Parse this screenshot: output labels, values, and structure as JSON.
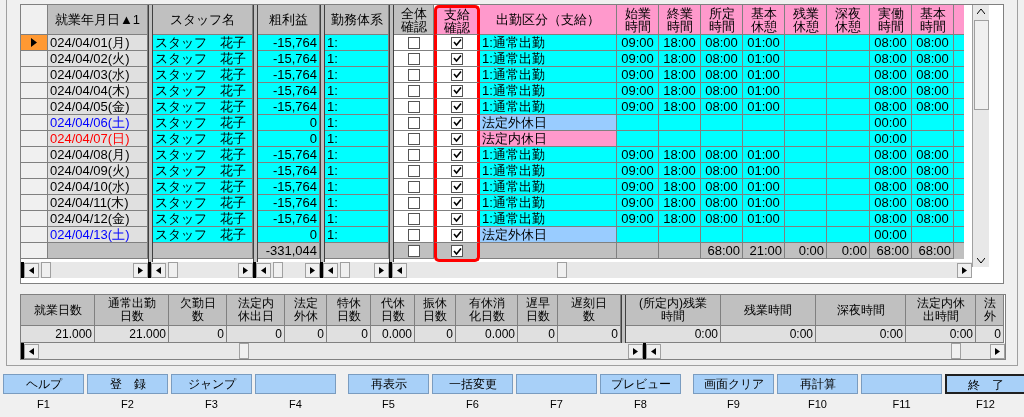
{
  "grid": {
    "columns": [
      {
        "lines": [
          "就業年月日▲1"
        ]
      },
      {
        "lines": [
          "スタッフ名"
        ]
      },
      {
        "lines": [
          "粗利益"
        ]
      },
      {
        "lines": [
          "勤務体系"
        ]
      },
      {
        "lines": [
          "全体",
          "確認"
        ]
      },
      {
        "lines": [
          "支給",
          "確認"
        ]
      },
      {
        "lines": [
          "出勤区分（支給）"
        ]
      },
      {
        "lines": [
          "始業",
          "時間"
        ]
      },
      {
        "lines": [
          "終業",
          "時間"
        ]
      },
      {
        "lines": [
          "所定",
          "時間"
        ]
      },
      {
        "lines": [
          "基本",
          "休憩"
        ]
      },
      {
        "lines": [
          "残業",
          "休憩"
        ]
      },
      {
        "lines": [
          "深夜",
          "休憩"
        ]
      },
      {
        "lines": [
          "実働",
          "時間"
        ]
      },
      {
        "lines": [
          "基本",
          "時間"
        ]
      }
    ],
    "rows": [
      {
        "selected": true,
        "date": {
          "text": "024/04/01(月)",
          "color": "#000000"
        },
        "staff": "スタッフ　花子",
        "profit": "-15,764",
        "shift": "1:",
        "all_check": false,
        "pay_check": true,
        "attendance": {
          "text": "1:通常出勤",
          "color": "#00ffff"
        },
        "start": "09:00",
        "end": "18:00",
        "scheduled": "08:00",
        "base_break": "01:00",
        "actual": "08:00",
        "base_time": "08:00"
      },
      {
        "selected": false,
        "date": {
          "text": "024/04/02(火)",
          "color": "#000000"
        },
        "staff": "スタッフ　花子",
        "profit": "-15,764",
        "shift": "1:",
        "all_check": false,
        "pay_check": true,
        "attendance": {
          "text": "1:通常出勤",
          "color": "#00ffff"
        },
        "start": "09:00",
        "end": "18:00",
        "scheduled": "08:00",
        "base_break": "01:00",
        "actual": "08:00",
        "base_time": "08:00"
      },
      {
        "selected": false,
        "date": {
          "text": "024/04/03(水)",
          "color": "#000000"
        },
        "staff": "スタッフ　花子",
        "profit": "-15,764",
        "shift": "1:",
        "all_check": false,
        "pay_check": true,
        "attendance": {
          "text": "1:通常出勤",
          "color": "#00ffff"
        },
        "start": "09:00",
        "end": "18:00",
        "scheduled": "08:00",
        "base_break": "01:00",
        "actual": "08:00",
        "base_time": "08:00"
      },
      {
        "selected": false,
        "date": {
          "text": "024/04/04(木)",
          "color": "#000000"
        },
        "staff": "スタッフ　花子",
        "profit": "-15,764",
        "shift": "1:",
        "all_check": false,
        "pay_check": true,
        "attendance": {
          "text": "1:通常出勤",
          "color": "#00ffff"
        },
        "start": "09:00",
        "end": "18:00",
        "scheduled": "08:00",
        "base_break": "01:00",
        "actual": "08:00",
        "base_time": "08:00"
      },
      {
        "selected": false,
        "date": {
          "text": "024/04/05(金)",
          "color": "#000000"
        },
        "staff": "スタッフ　花子",
        "profit": "-15,764",
        "shift": "1:",
        "all_check": false,
        "pay_check": true,
        "attendance": {
          "text": "1:通常出勤",
          "color": "#00ffff"
        },
        "start": "09:00",
        "end": "18:00",
        "scheduled": "08:00",
        "base_break": "01:00",
        "actual": "08:00",
        "base_time": "08:00"
      },
      {
        "selected": false,
        "date": {
          "text": "024/04/06(土)",
          "color": "#0000ff"
        },
        "staff": "スタッフ　花子",
        "profit": "0",
        "shift": "1:",
        "all_check": false,
        "pay_check": true,
        "attendance": {
          "text": "法定外休日",
          "color": "#99ccff"
        },
        "actual": "00:00"
      },
      {
        "selected": false,
        "date": {
          "text": "024/04/07(日)",
          "color": "#ff0000"
        },
        "staff": "スタッフ　花子",
        "profit": "0",
        "shift": "1:",
        "all_check": false,
        "pay_check": true,
        "attendance": {
          "text": "法定内休日",
          "color": "#ff99cc"
        },
        "actual": "00:00"
      },
      {
        "selected": false,
        "date": {
          "text": "024/04/08(月)",
          "color": "#000000"
        },
        "staff": "スタッフ　花子",
        "profit": "-15,764",
        "shift": "1:",
        "all_check": false,
        "pay_check": true,
        "attendance": {
          "text": "1:通常出勤",
          "color": "#00ffff"
        },
        "start": "09:00",
        "end": "18:00",
        "scheduled": "08:00",
        "base_break": "01:00",
        "actual": "08:00",
        "base_time": "08:00"
      },
      {
        "selected": false,
        "date": {
          "text": "024/04/09(火)",
          "color": "#000000"
        },
        "staff": "スタッフ　花子",
        "profit": "-15,764",
        "shift": "1:",
        "all_check": false,
        "pay_check": true,
        "attendance": {
          "text": "1:通常出勤",
          "color": "#00ffff"
        },
        "start": "09:00",
        "end": "18:00",
        "scheduled": "08:00",
        "base_break": "01:00",
        "actual": "08:00",
        "base_time": "08:00"
      },
      {
        "selected": false,
        "date": {
          "text": "024/04/10(水)",
          "color": "#000000"
        },
        "staff": "スタッフ　花子",
        "profit": "-15,764",
        "shift": "1:",
        "all_check": false,
        "pay_check": true,
        "attendance": {
          "text": "1:通常出勤",
          "color": "#00ffff"
        },
        "start": "09:00",
        "end": "18:00",
        "scheduled": "08:00",
        "base_break": "01:00",
        "actual": "08:00",
        "base_time": "08:00"
      },
      {
        "selected": false,
        "date": {
          "text": "024/04/11(木)",
          "color": "#000000"
        },
        "staff": "スタッフ　花子",
        "profit": "-15,764",
        "shift": "1:",
        "all_check": false,
        "pay_check": true,
        "attendance": {
          "text": "1:通常出勤",
          "color": "#00ffff"
        },
        "start": "09:00",
        "end": "18:00",
        "scheduled": "08:00",
        "base_break": "01:00",
        "actual": "08:00",
        "base_time": "08:00"
      },
      {
        "selected": false,
        "date": {
          "text": "024/04/12(金)",
          "color": "#000000"
        },
        "staff": "スタッフ　花子",
        "profit": "-15,764",
        "shift": "1:",
        "all_check": false,
        "pay_check": true,
        "attendance": {
          "text": "1:通常出勤",
          "color": "#00ffff"
        },
        "start": "09:00",
        "end": "18:00",
        "scheduled": "08:00",
        "base_break": "01:00",
        "actual": "08:00",
        "base_time": "08:00"
      },
      {
        "selected": false,
        "date": {
          "text": "024/04/13(土)",
          "color": "#0000ff"
        },
        "staff": "スタッフ　花子",
        "profit": "0",
        "shift": "1:",
        "all_check": false,
        "pay_check": true,
        "attendance": {
          "text": "法定外休日",
          "color": "#99ccff"
        },
        "actual": "00:00"
      }
    ],
    "totals": {
      "profit": "-331,044",
      "all_check": false,
      "pay_check": true,
      "scheduled": "68:00",
      "base_break": "21:00",
      "ot_break": "0:00",
      "night_break": "0:00",
      "actual": "68:00",
      "base_time": "68:00"
    }
  },
  "summary": {
    "left": [
      {
        "lines": [
          "就業日数"
        ],
        "value": "21.000"
      },
      {
        "lines": [
          "通常出勤",
          "日数"
        ],
        "value": "21.000"
      },
      {
        "lines": [
          "欠勤日",
          "数"
        ],
        "value": "0"
      },
      {
        "lines": [
          "法定内",
          "休出日"
        ],
        "value": "0"
      },
      {
        "lines": [
          "法定",
          "外休"
        ],
        "value": "0"
      },
      {
        "lines": [
          "特休",
          "日数"
        ],
        "value": "0"
      },
      {
        "lines": [
          "代休",
          "日数"
        ],
        "value": "0.000"
      },
      {
        "lines": [
          "振休",
          "日数"
        ],
        "value": "0"
      },
      {
        "lines": [
          "有休消",
          "化日数"
        ],
        "value": "0.000"
      },
      {
        "lines": [
          "遅早",
          "日数"
        ],
        "value": "0"
      },
      {
        "lines": [
          "遅刻日",
          "数"
        ],
        "value": "0"
      }
    ],
    "right": [
      {
        "lines": [
          "(所定内)残業",
          "時間"
        ],
        "value": "0:00"
      },
      {
        "lines": [
          "残業時間"
        ],
        "value": "0:00"
      },
      {
        "lines": [
          "深夜時間"
        ],
        "value": "0:00"
      },
      {
        "lines": [
          "法定内休",
          "出時間"
        ],
        "value": "0:00"
      },
      {
        "lines": [
          "法",
          "外"
        ],
        "value": "0"
      }
    ]
  },
  "function_keys": [
    {
      "label": "ヘルプ",
      "key": "F1",
      "default": false
    },
    {
      "label": "登　録",
      "key": "F2",
      "default": false
    },
    {
      "label": "ジャンプ",
      "key": "F3",
      "default": false
    },
    {
      "key": "F4",
      "default": false
    },
    {
      "label": "再表示",
      "key": "F5",
      "default": false
    },
    {
      "label": "一括変更",
      "key": "F6",
      "default": false
    },
    {
      "key": "F7",
      "default": false
    },
    {
      "label": "プレビュー",
      "key": "F8",
      "default": false
    },
    {
      "label": "画面クリア",
      "key": "F9",
      "default": false
    },
    {
      "label": "再計算",
      "key": "F10",
      "default": false
    },
    {
      "key": "F11",
      "default": false
    },
    {
      "label": "終　了",
      "key": "F12",
      "default": true
    }
  ]
}
